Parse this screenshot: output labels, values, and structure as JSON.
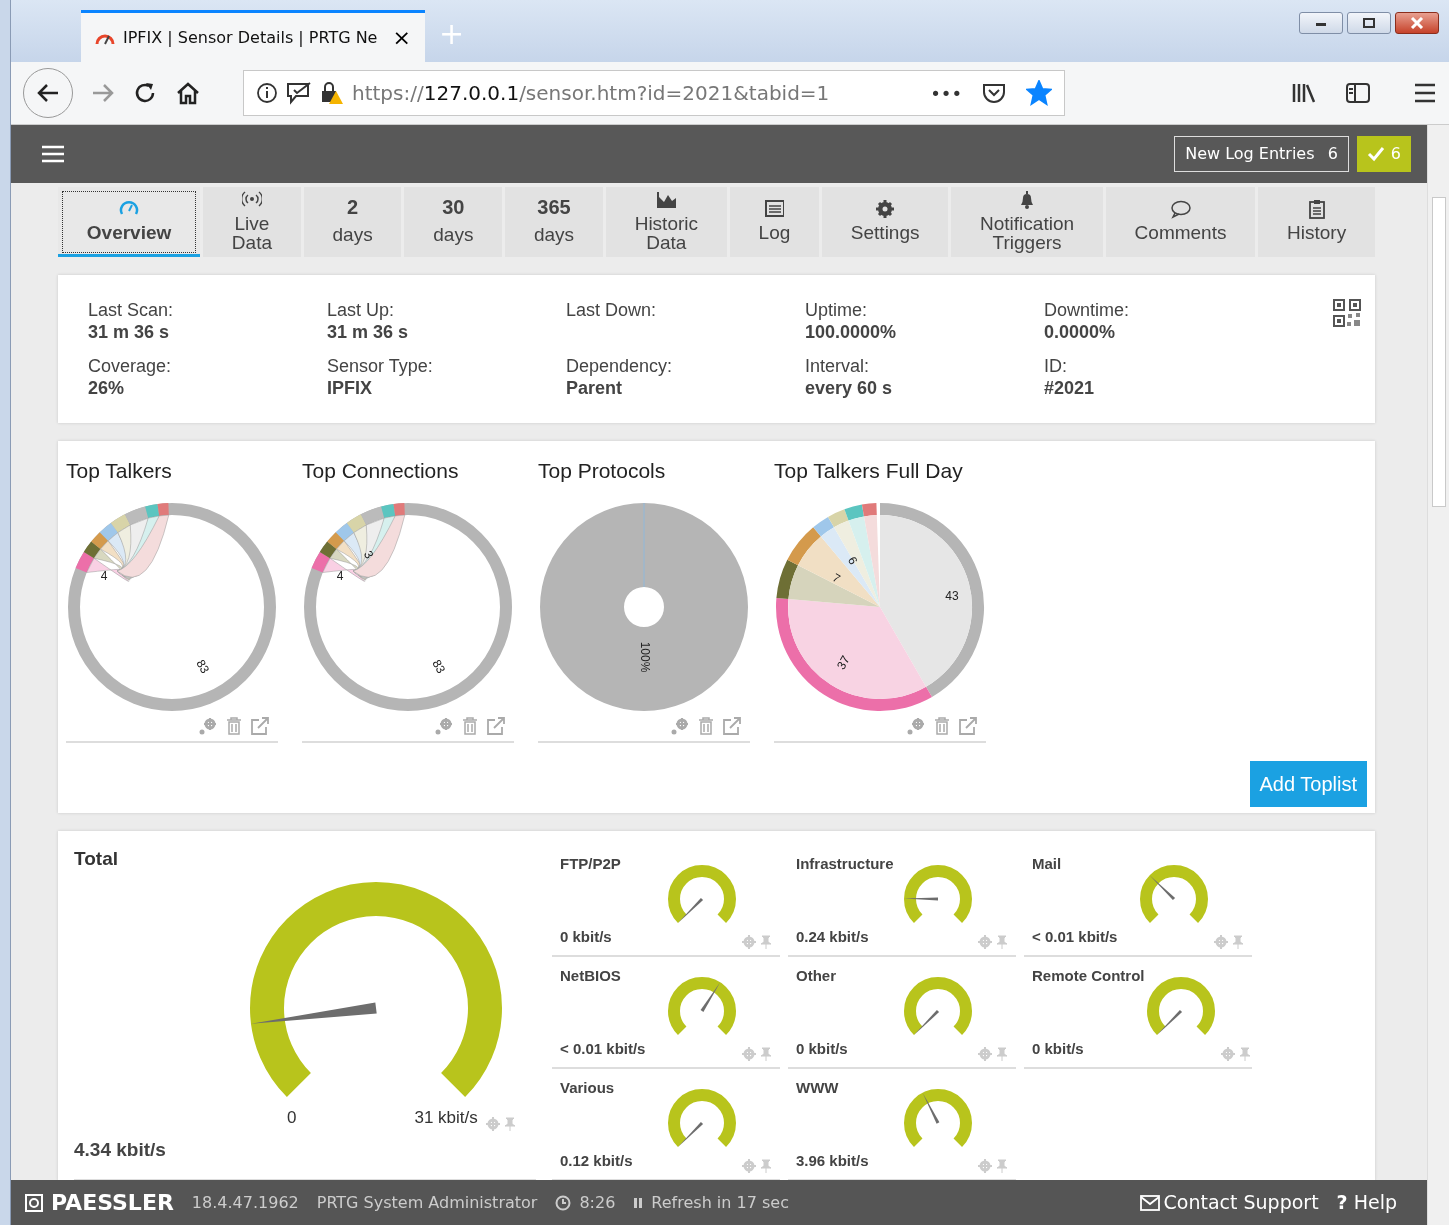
{
  "browser": {
    "tab_title": "IPFIX | Sensor Details | PRTG Ne",
    "tab_close": "×",
    "new_tab": "+",
    "url_scheme": "https://",
    "url_host": "127.0.0.1",
    "url_path": "/sensor.htm?id=2021&tabid=1",
    "more": "•••",
    "bookmarked": true
  },
  "topbar": {
    "log_label": "New Log Entries",
    "log_count": "6",
    "ok_count": "6"
  },
  "tabs": [
    {
      "lines": [
        "Overview"
      ],
      "selected": true
    },
    {
      "lines": [
        "Live",
        "Data"
      ],
      "selected": false
    },
    {
      "number": "2",
      "lines": [
        "days"
      ],
      "selected": false
    },
    {
      "number": "30",
      "lines": [
        "days"
      ],
      "selected": false
    },
    {
      "number": "365",
      "lines": [
        "days"
      ],
      "selected": false
    },
    {
      "lines": [
        "Historic",
        "Data"
      ],
      "selected": false
    },
    {
      "lines": [
        "Log"
      ],
      "selected": false
    },
    {
      "lines": [
        "Settings"
      ],
      "selected": false
    },
    {
      "lines": [
        "Notification",
        "Triggers"
      ],
      "selected": false
    },
    {
      "lines": [
        "Comments"
      ],
      "selected": false
    },
    {
      "lines": [
        "History"
      ],
      "selected": false
    }
  ],
  "details": [
    {
      "label": "Last Scan:",
      "value": "31 m 36 s"
    },
    {
      "label": "Last Up:",
      "value": "31 m 36 s"
    },
    {
      "label": "Last Down:"
    },
    {
      "label": "Uptime:",
      "value": "100.0000%"
    },
    {
      "label": "Downtime:",
      "value": "0.0000%"
    },
    {
      "label": "Coverage:",
      "value": "26%"
    },
    {
      "label": "Sensor Type:",
      "value": "IPFIX"
    },
    {
      "label": "Dependency:",
      "value": "Parent"
    },
    {
      "label": "Interval:",
      "value": "every 60 s"
    },
    {
      "label": "ID:",
      "value": "#2021"
    }
  ],
  "toplists": [
    {
      "title": "Top Talkers",
      "kind": "ring",
      "labels": [
        "4",
        "83"
      ]
    },
    {
      "title": "Top Connections",
      "kind": "ring",
      "labels": [
        "4",
        "83",
        "3"
      ]
    },
    {
      "title": "Top Protocols",
      "kind": "donut",
      "labels": [
        "100%"
      ]
    },
    {
      "title": "Top Talkers Full Day",
      "kind": "pie",
      "labels": [
        "6",
        "7",
        "43",
        "37"
      ]
    }
  ],
  "add_toplist": "Add Toplist",
  "total": {
    "name": "Total",
    "value": "4.34 kbit/s",
    "min": "0",
    "max": "31 kbit/s"
  },
  "channels": [
    {
      "name": "FTP/P2P",
      "value": "0 kbit/s"
    },
    {
      "name": "Infrastructure",
      "value": "0.24 kbit/s"
    },
    {
      "name": "Mail",
      "value": "< 0.01 kbit/s"
    },
    {
      "name": "NetBIOS",
      "value": "< 0.01 kbit/s"
    },
    {
      "name": "Other",
      "value": "0 kbit/s"
    },
    {
      "name": "Remote Control",
      "value": "0 kbit/s"
    },
    {
      "name": "Various",
      "value": "0.12 kbit/s"
    },
    {
      "name": "WWW",
      "value": "3.96 kbit/s"
    }
  ],
  "footer": {
    "brand": "PAESSLER",
    "version": "18.4.47.1962",
    "user": "PRTG System Administrator",
    "time": "8:26",
    "refresh": "Refresh in 17 sec",
    "contact": "Contact Support",
    "help": "**?** Help"
  }
}
